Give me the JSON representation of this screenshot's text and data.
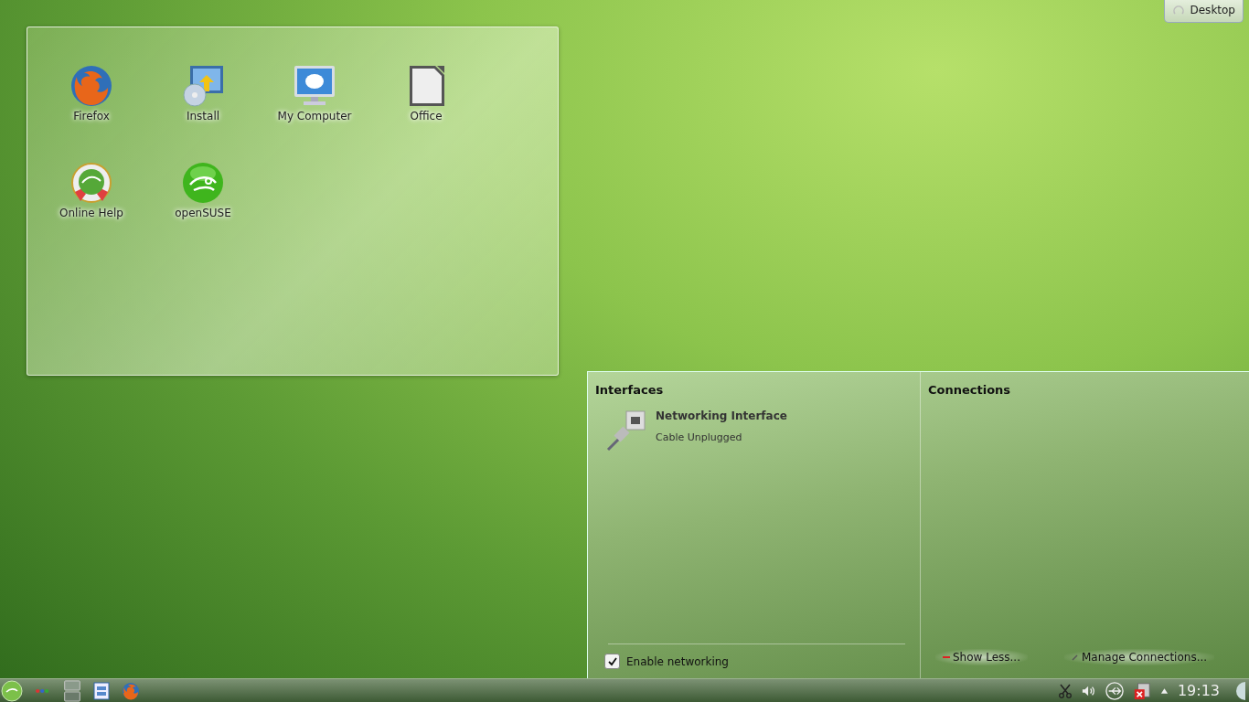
{
  "desktop_button": {
    "label": "Desktop"
  },
  "folder_view": {
    "icons": [
      {
        "label": "Firefox",
        "kind": "firefox"
      },
      {
        "label": "Install",
        "kind": "install"
      },
      {
        "label": "My Computer",
        "kind": "computer"
      },
      {
        "label": "Office",
        "kind": "office"
      },
      {
        "label": "Online Help",
        "kind": "help"
      },
      {
        "label": "openSUSE",
        "kind": "opensuse"
      }
    ]
  },
  "network_popup": {
    "interfaces": {
      "title": "Interfaces",
      "items": [
        {
          "name": "Networking Interface",
          "status": "Cable Unplugged"
        }
      ]
    },
    "enable_networking": {
      "label": "Enable networking",
      "checked": true
    },
    "connections": {
      "title": "Connections"
    },
    "buttons": [
      {
        "label": "Show Less...",
        "kind": "less"
      },
      {
        "label": "Manage Connections...",
        "kind": "manage"
      }
    ]
  },
  "taskbar": {
    "launchers": [
      {
        "kind": "kickoff"
      },
      {
        "kind": "activities"
      },
      {
        "kind": "pager"
      },
      {
        "kind": "files"
      },
      {
        "kind": "firefox"
      }
    ],
    "tray": [
      {
        "kind": "clipboard"
      },
      {
        "kind": "volume"
      },
      {
        "kind": "network"
      },
      {
        "kind": "updater"
      },
      {
        "kind": "expand"
      }
    ],
    "clock": "19:13"
  }
}
